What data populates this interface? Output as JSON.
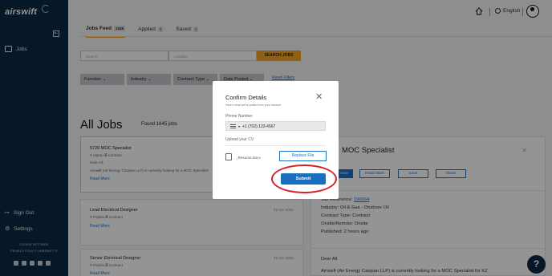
{
  "brand": {
    "logo_text": "airswift"
  },
  "sidebar": {
    "jobs_label": "Jobs",
    "sign_out_label": "Sign Out",
    "settings_label": "Settings",
    "footer_line1": "COOKIE SETTINGS",
    "footer_line2": "PRIVACY POLICY | AIRSWIFT ®"
  },
  "header": {
    "language": "English"
  },
  "tabs": [
    {
      "label": "Jobs Feed",
      "count": "1645"
    },
    {
      "label": "Applied",
      "count": "0"
    },
    {
      "label": "Saved",
      "count": "1"
    }
  ],
  "search": {
    "search_placeholder": "Search",
    "location_placeholder": "Location",
    "button_label": "SEARCH JOBS"
  },
  "filters": {
    "function": "Function",
    "industry": "Industry",
    "contract_type": "Contract Type",
    "date_posted": "Date Posted",
    "reset": "Reset Filters"
  },
  "listing": {
    "title": "All Jobs",
    "found": "Found 1645 jobs"
  },
  "jobs": [
    {
      "title": "5720 MOC Specialist",
      "location": "Atyrau",
      "contract": "Contract",
      "line3": "Dear All,",
      "description": "Airswift (Air Energy Caspian LLP) is currently looking for a MOC Specialist",
      "read_more": "Read More"
    },
    {
      "title": "Lead Electrical Designer",
      "location": "Pirpiria",
      "contract": "Contract",
      "date": "22 Jun 2023",
      "read_more": "Read More"
    },
    {
      "title": "Senior Electrical Designer",
      "location": "Pirpiria",
      "contract": "Contract",
      "date": "22 Jun 2023",
      "read_more": "Read More"
    }
  ],
  "detail": {
    "title": "MOC Specialist",
    "apply": "Now",
    "read_more": "Read More",
    "save": "Save",
    "share": "Share",
    "job_reference_label": "Job Reference:",
    "job_reference": "190664",
    "industry": "Industry: Oil & Gas - Onshore Oil",
    "contract_type": "Contract Type: Contract",
    "onsite": "Onsite/Remote: Onsite",
    "published": "Published: 2 hours ago",
    "greeting": "Dear All",
    "body": "Airswift (Air Energy Caspian LLP) is currently looking for a MOC Specialist for KZ"
  },
  "modal": {
    "title": "Confirm Details",
    "subtitle": "Here's what we've pulled from your account",
    "phone_label": "Phone Number",
    "phone_value": "+1 (702) 123-4567",
    "cv_label": "Upload your CV",
    "file_name": "_Resume.docx",
    "replace_label": "Replace File",
    "submit_label": "Submit"
  },
  "help": {
    "label": "?"
  },
  "colors": {
    "sidebar": "#0b2a45",
    "accent": "#f6a623",
    "primary": "#1a73c9",
    "highlight": "#d6202a"
  }
}
